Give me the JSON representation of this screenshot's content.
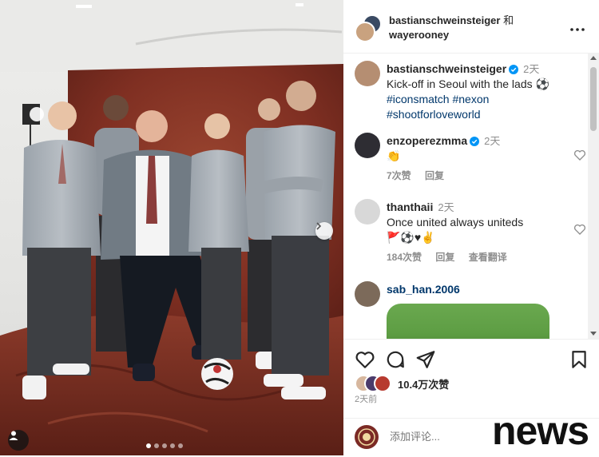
{
  "header": {
    "author1": "bastianschweinsteiger",
    "joiner": "和",
    "author2": "wayerooney",
    "more_icon": "more-horizontal-icon"
  },
  "caption": {
    "username": "bastianschweinsteiger",
    "verified": true,
    "time": "2天",
    "text": "Kick-off in Seoul with the lads ⚽",
    "hashtags": [
      "#iconsmatch",
      "#nexon",
      "#shootforloveworld"
    ]
  },
  "comments": [
    {
      "username": "enzoperezmma",
      "verified": true,
      "time": "2天",
      "text": "👏",
      "likes": "7次赞",
      "reply": "回复"
    },
    {
      "username": "thanthaii",
      "verified": false,
      "time": "2天",
      "text": "Once united always uniteds",
      "emoji_line": "🚩⚽♥✌",
      "likes": "184次赞",
      "reply": "回复",
      "translate": "查看翻译"
    },
    {
      "username": "sab_han.2006",
      "verified": false,
      "time": "",
      "text": "",
      "has_media": true
    }
  ],
  "actions": {
    "like_icon": "heart-icon",
    "comment_icon": "comment-icon",
    "share_icon": "send-icon",
    "save_icon": "bookmark-icon",
    "likes_count": "10.4万次赞",
    "posted": "2天前"
  },
  "comment_input": {
    "placeholder": "添加评论..."
  },
  "carousel": {
    "total": 5,
    "current": 1,
    "next_icon": "chevron-right-icon",
    "tag_icon": "user-tag-icon"
  },
  "watermark": "news",
  "colors": {
    "link": "#00376b",
    "verified": "#0095f6",
    "muted": "#8e8e8e",
    "backdrop": "#8a3524"
  }
}
